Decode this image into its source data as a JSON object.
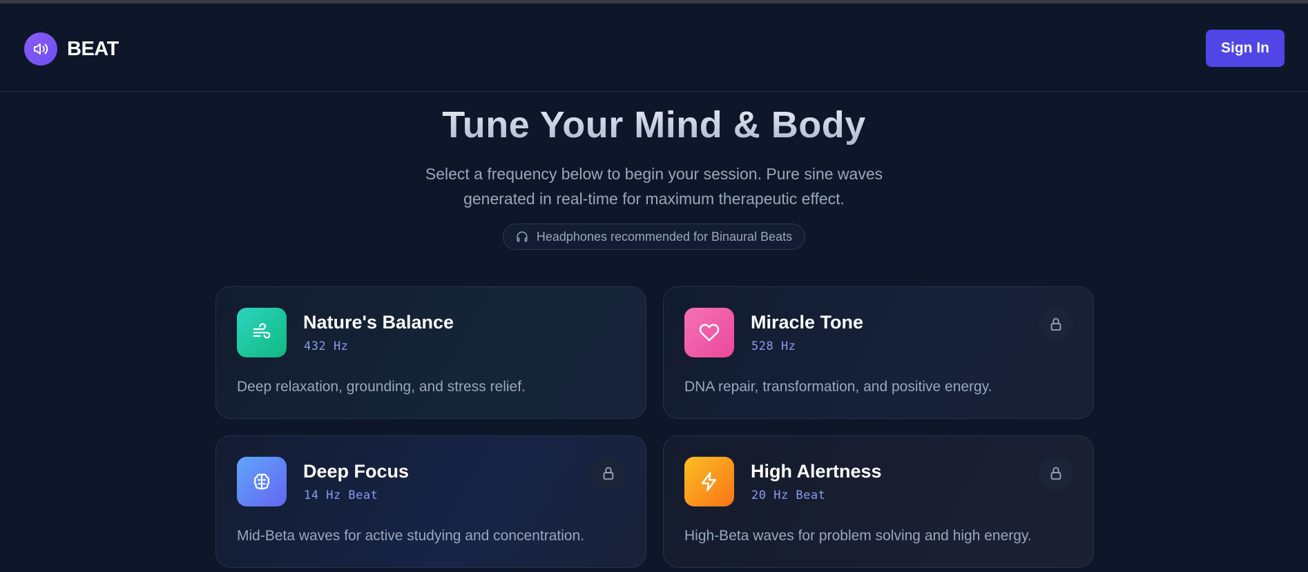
{
  "app": {
    "name": "BEAT"
  },
  "header": {
    "signin_label": "Sign In"
  },
  "hero": {
    "title": "Tune Your Mind & Body",
    "subtitle": "Select a frequency below to begin your session. Pure sine waves generated in real-time for maximum therapeutic effect.",
    "notice": "Headphones recommended for Binaural Beats"
  },
  "cards": [
    {
      "title": "Nature's Balance",
      "freq": "432 Hz",
      "desc": "Deep relaxation, grounding, and stress relief.",
      "icon": "wind-icon",
      "locked": false,
      "color": "#10b981"
    },
    {
      "title": "Miracle Tone",
      "freq": "528 Hz",
      "desc": "DNA repair, transformation, and positive energy.",
      "icon": "heart-icon",
      "locked": true,
      "color": "#ec4899"
    },
    {
      "title": "Deep Focus",
      "freq": "14 Hz Beat",
      "desc": "Mid-Beta waves for active studying and concentration.",
      "icon": "brain-icon",
      "locked": true,
      "color": "#6366f1"
    },
    {
      "title": "High Alertness",
      "freq": "20 Hz Beat",
      "desc": "High-Beta waves for problem solving and high energy.",
      "icon": "lightning-icon",
      "locked": true,
      "color": "#f97316"
    }
  ],
  "colors": {
    "background": "#0e1629",
    "accent": "#4f46e5",
    "brand": "#8b5cf6"
  }
}
